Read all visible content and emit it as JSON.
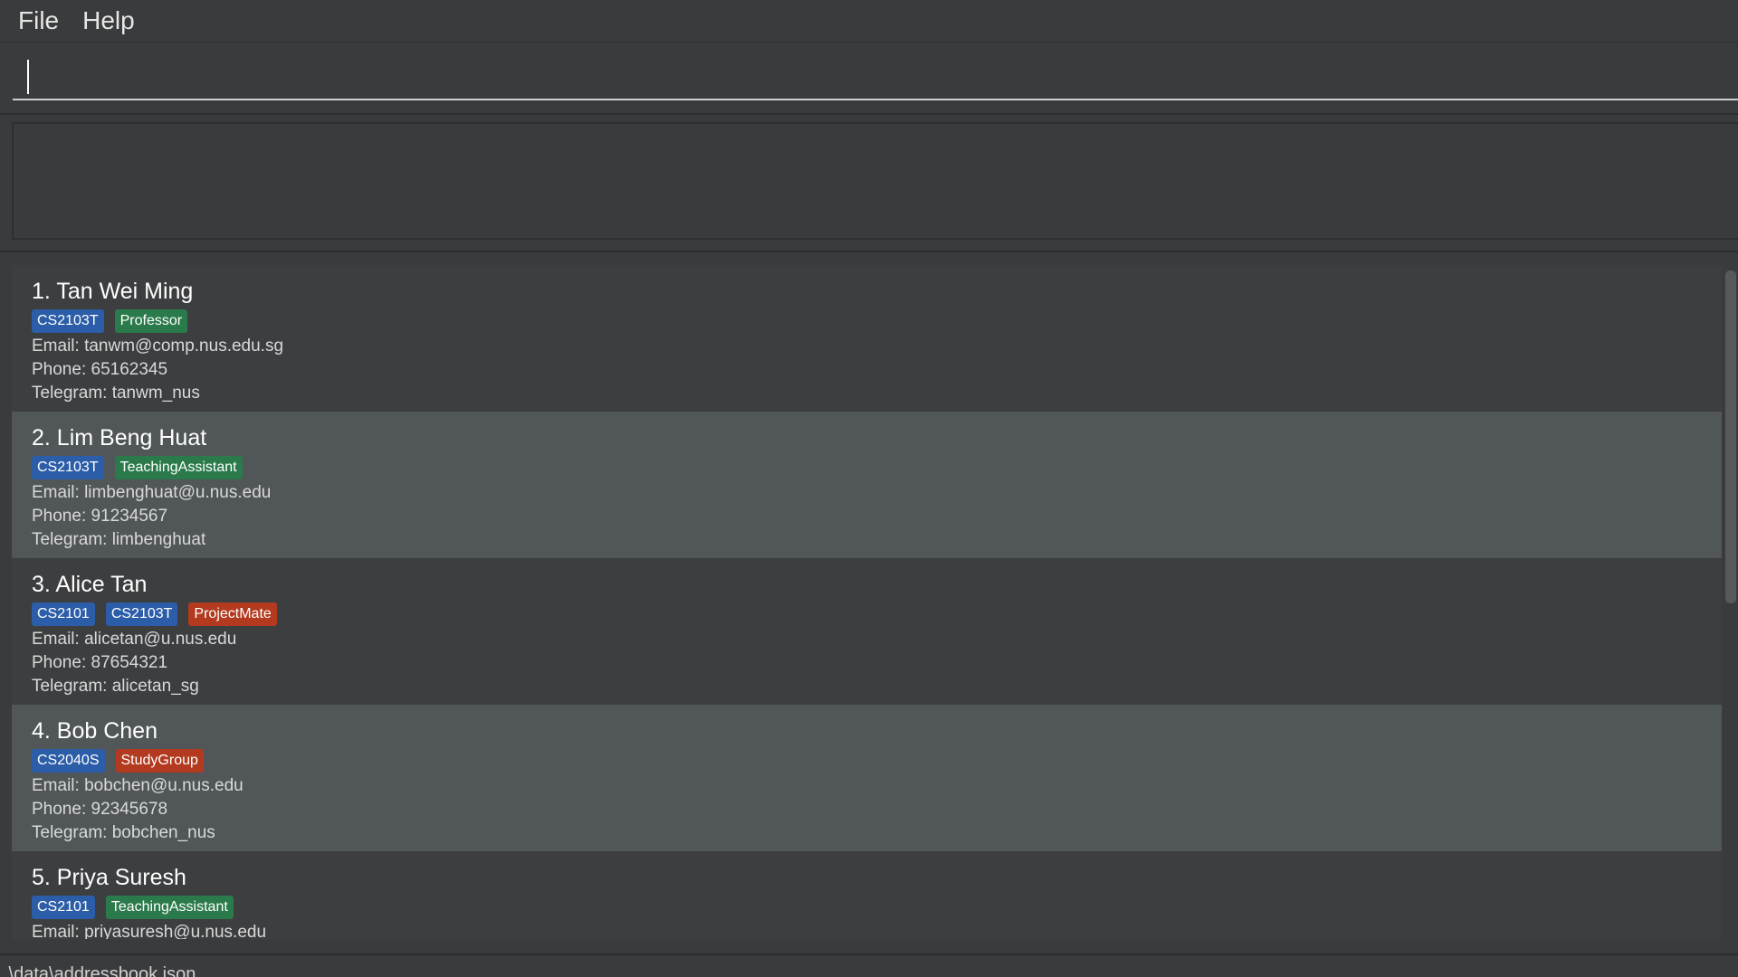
{
  "menu": {
    "file_label": "File",
    "help_label": "Help"
  },
  "command_box": {
    "value": "",
    "placeholder": ""
  },
  "result_display": {
    "text": ""
  },
  "colors": {
    "tag_module": "#2c5da8",
    "tag_role_green": "#2b7a4b",
    "tag_role_red": "#b33a1f"
  },
  "persons": [
    {
      "name": "1. Tan Wei Ming",
      "tags": [
        {
          "label": "CS2103T",
          "color": "#2c5da8"
        },
        {
          "label": "Professor",
          "color": "#2b7a4b"
        }
      ],
      "email": "Email: tanwm@comp.nus.edu.sg",
      "phone": "Phone: 65162345",
      "telegram": "Telegram: tanwm_nus"
    },
    {
      "name": "2. Lim Beng Huat",
      "tags": [
        {
          "label": "CS2103T",
          "color": "#2c5da8"
        },
        {
          "label": "TeachingAssistant",
          "color": "#2b7a4b"
        }
      ],
      "email": "Email: limbenghuat@u.nus.edu",
      "phone": "Phone: 91234567",
      "telegram": "Telegram: limbenghuat"
    },
    {
      "name": "3. Alice Tan",
      "tags": [
        {
          "label": "CS2101",
          "color": "#2c5da8"
        },
        {
          "label": "CS2103T",
          "color": "#2c5da8"
        },
        {
          "label": "ProjectMate",
          "color": "#b33a1f"
        }
      ],
      "email": "Email: alicetan@u.nus.edu",
      "phone": "Phone: 87654321",
      "telegram": "Telegram: alicetan_sg"
    },
    {
      "name": "4. Bob Chen",
      "tags": [
        {
          "label": "CS2040S",
          "color": "#2c5da8"
        },
        {
          "label": "StudyGroup",
          "color": "#b33a1f"
        }
      ],
      "email": "Email: bobchen@u.nus.edu",
      "phone": "Phone: 92345678",
      "telegram": "Telegram: bobchen_nus"
    },
    {
      "name": "5. Priya Suresh",
      "tags": [
        {
          "label": "CS2101",
          "color": "#2c5da8"
        },
        {
          "label": "TeachingAssistant",
          "color": "#2b7a4b"
        }
      ],
      "email": "Email: priyasuresh@u.nus.edu",
      "phone": "",
      "telegram": ""
    }
  ],
  "status_bar": {
    "path": ".\\data\\addressbook.json"
  }
}
